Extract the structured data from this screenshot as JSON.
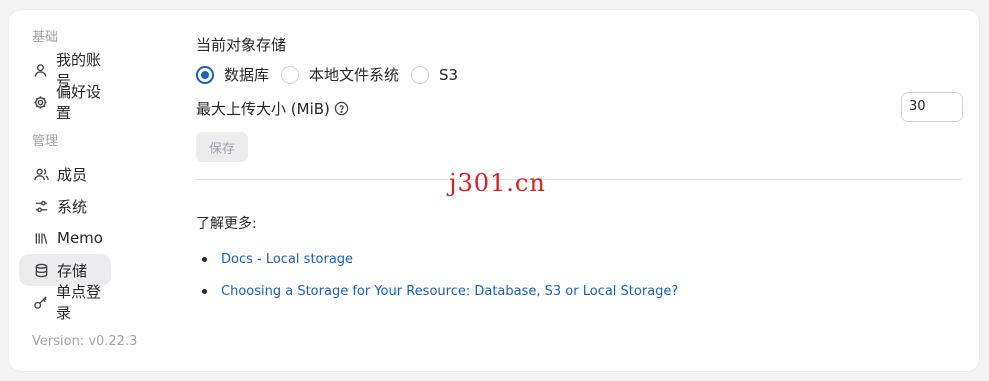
{
  "sidebar": {
    "basic_title": "基础",
    "basic_items": [
      {
        "label": "我的账号",
        "icon": "user-icon"
      },
      {
        "label": "偏好设置",
        "icon": "gear-icon"
      }
    ],
    "manage_title": "管理",
    "manage_items": [
      {
        "label": "成员",
        "icon": "users-icon"
      },
      {
        "label": "系统",
        "icon": "sliders-icon"
      },
      {
        "label": "Memo",
        "icon": "library-icon"
      },
      {
        "label": "存储",
        "icon": "database-icon",
        "active": true
      },
      {
        "label": "单点登录",
        "icon": "key-icon"
      }
    ],
    "version": "Version: v0.22.3"
  },
  "storage": {
    "title": "当前对象存储",
    "options": [
      {
        "label": "数据库",
        "checked": true
      },
      {
        "label": "本地文件系统",
        "checked": false
      },
      {
        "label": "S3",
        "checked": false
      }
    ],
    "max_upload_label": "最大上传大小 (MiB)",
    "max_upload_value": "30",
    "save_label": "保存"
  },
  "learn_more": {
    "title": "了解更多:",
    "links": [
      "Docs - Local storage",
      "Choosing a Storage for Your Resource: Database, S3 or Local Storage?"
    ]
  },
  "watermark": "j301.cn",
  "colors": {
    "accent": "#1d5fb8",
    "watermark": "#d92020"
  }
}
